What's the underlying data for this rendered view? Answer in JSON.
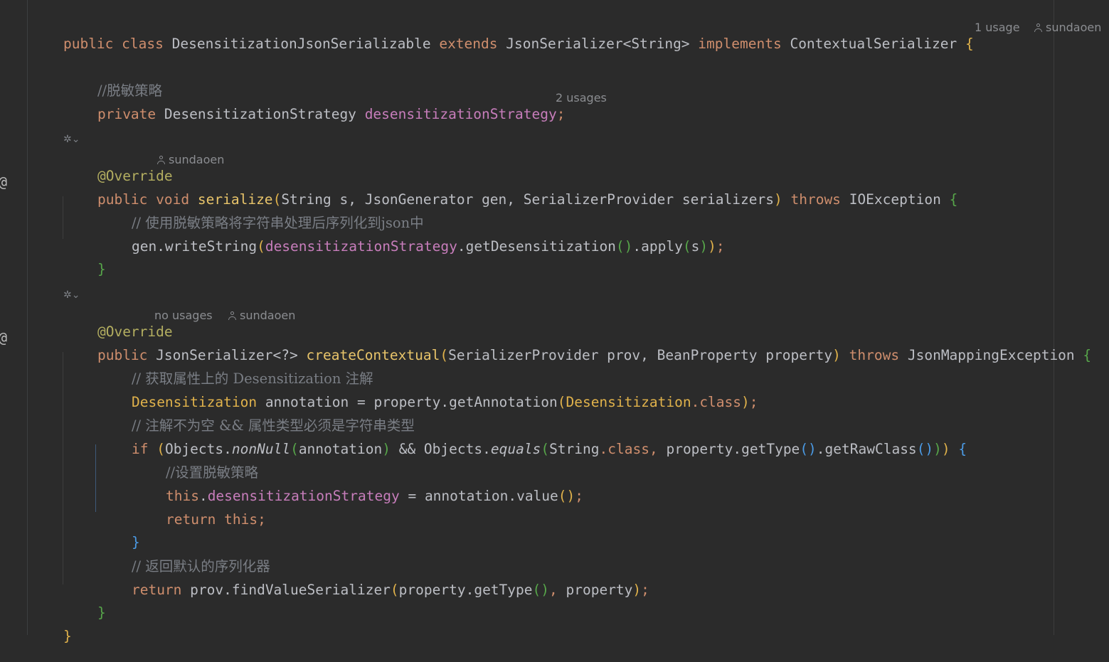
{
  "hints": {
    "class_usage": "1 usage",
    "author": "sundaoen",
    "field_usages": "2 usages",
    "no_usages": "no usages"
  },
  "code": {
    "kw_public": "public",
    "kw_class": "class",
    "class_name": "DesensitizationJsonSerializable",
    "kw_extends": "extends",
    "parent_type": "JsonSerializer<String>",
    "kw_implements": "implements",
    "iface": "ContextualSerializer",
    "brace_open": "{",
    "brace_close": "}",
    "comment_strategy": "//脱敏策略",
    "kw_private": "private",
    "strategy_type": "DesensitizationStrategy",
    "strategy_field": "desensitizationStrategy",
    "semicolon": ";",
    "override": "@Override",
    "kw_void": "void",
    "m_serialize": "serialize",
    "serialize_params": "String s, JsonGenerator gen, SerializerProvider serializers",
    "kw_throws": "throws",
    "io_exception": "IOException",
    "comment_serialize": "// 使用脱敏策略将字符串处理后序列化到json中",
    "write_string_prefix": "gen.writeString",
    "get_desens": ".getDesensitization",
    "apply_call": ".apply",
    "s_arg": "s",
    "json_serializer_generic": "JsonSerializer<?>",
    "m_create": "createContextual",
    "create_params": "SerializerProvider prov, BeanProperty property",
    "json_mapping_exception": "JsonMappingException",
    "comment_get_annotation": "// 获取属性上的 Desensitization 注解",
    "annotation_type": "Desensitization",
    "annotation_var": " annotation = property.getAnnotation",
    "dot_class": ".class",
    "comment_condition": "// 注解不为空 && 属性类型必须是字符串类型",
    "kw_if": "if",
    "objects": "Objects.",
    "non_null": "nonNull",
    "annotation_arg": "annotation",
    "and_objects": " && Objects.",
    "equals_fn": "equals",
    "string_type": "String",
    "property_get_type": " property.getType",
    "get_raw_class": ".getRawClass",
    "comment_set_strategy": "//设置脱敏策略",
    "kw_this": "this",
    "assign_annotation_value": " = annotation.value",
    "kw_return": "return",
    "comment_default": "// 返回默认的序列化器",
    "prov_find": " prov.findValueSerializer",
    "property_get_type2": "property.getType",
    "property_arg": " property"
  },
  "icons": [
    "at-sign-icon",
    "ai-assistant-icon",
    "chevron-down-icon",
    "person-icon"
  ]
}
